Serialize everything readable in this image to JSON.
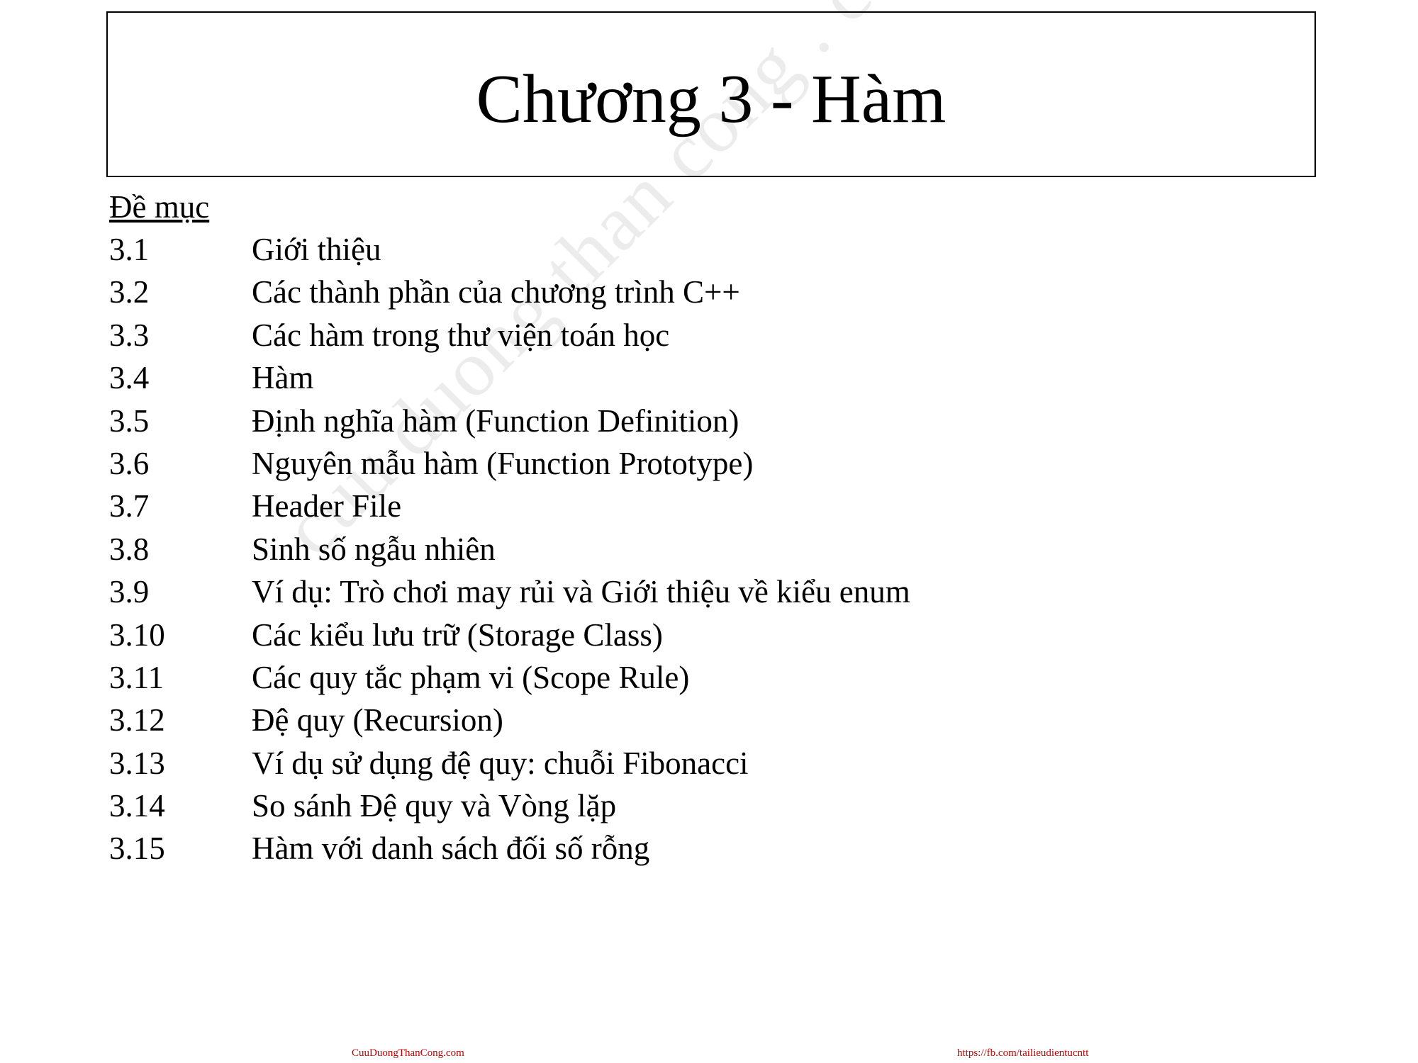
{
  "slide": {
    "title": "Chương 3 - Hàm",
    "toc_heading": "Đề mục",
    "items": [
      {
        "num": "3.1",
        "label": "Giới thiệu"
      },
      {
        "num": "3.2",
        "label": "Các thành phần của chương trình C++"
      },
      {
        "num": "3.3",
        "label": "Các hàm trong thư viện toán học"
      },
      {
        "num": "3.4",
        "label": "Hàm"
      },
      {
        "num": "3.5",
        "label": "Định nghĩa hàm (Function Definition)"
      },
      {
        "num": "3.6",
        "label": "Nguyên mẫu hàm (Function Prototype)"
      },
      {
        "num": "3.7",
        "label": "Header File"
      },
      {
        "num": "3.8",
        "label": "Sinh số ngẫu nhiên"
      },
      {
        "num": "3.9",
        "label": "Ví dụ: Trò chơi may rủi và Giới thiệu về kiểu enum"
      },
      {
        "num": "3.10",
        "label": "Các kiểu lưu trữ (Storage Class)"
      },
      {
        "num": "3.11",
        "label": "Các quy tắc phạm vi (Scope Rule)"
      },
      {
        "num": "3.12",
        "label": "Đệ quy (Recursion)"
      },
      {
        "num": "3.13",
        "label": "Ví dụ sử dụng đệ quy: chuỗi Fibonacci"
      },
      {
        "num": "3.14",
        "label": "So sánh Đệ quy và Vòng lặp"
      },
      {
        "num": "3.15",
        "label": "Hàm với danh sách đối số rỗng"
      }
    ]
  },
  "watermark": "cuu duong than cong . com",
  "footer": {
    "left_link": "CuuDuongThanCong.com",
    "right_link": "https://fb.com/tailieudientucntt",
    "link_color": "#c00000"
  }
}
